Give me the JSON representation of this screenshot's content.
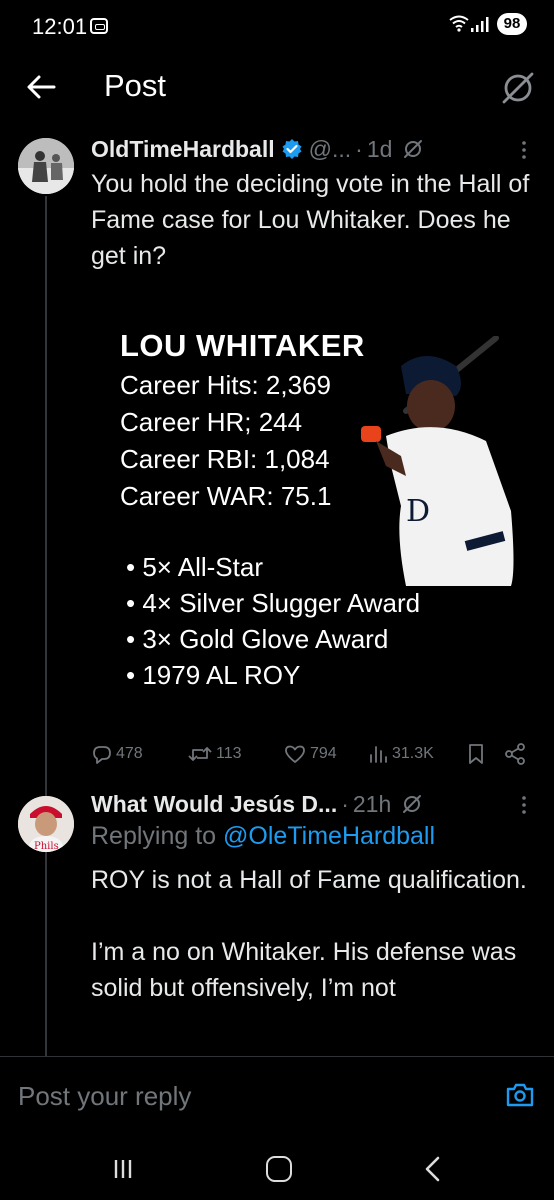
{
  "status_bar": {
    "time": "12:01",
    "battery": "98"
  },
  "header": {
    "title": "Post"
  },
  "post": {
    "display_name": "OldTimeHardball",
    "handle": "@...",
    "separator": "·",
    "time": "1d",
    "text": "You hold the deciding vote in the Hall of Fame case for Lou Whitaker. Does he get in?",
    "card": {
      "title": "LOU WHITAKER",
      "stats": [
        "Career Hits: 2,369",
        "Career HR; 244",
        "Career RBI: 1,084",
        "Career WAR: 75.1"
      ],
      "bullets": [
        "• 5× All-Star",
        "• 4× Silver Slugger Award",
        "• 3× Gold Glove Award",
        "• 1979 AL ROY"
      ]
    },
    "actions": {
      "replies": "478",
      "reposts": "113",
      "likes": "794",
      "views": "31.3K"
    }
  },
  "reply": {
    "display_name": "What Would Jesús D...",
    "separator": "·",
    "time": "21h",
    "replying_to_prefix": "Replying to ",
    "replying_to_handle": "@OleTimeHardball",
    "text_p1": "ROY is not a Hall of Fame qualification.",
    "text_p2": "I’m a no on Whitaker. His defense was solid but offensively, I’m not"
  },
  "reply_bar": {
    "placeholder": "Post your reply"
  },
  "colors": {
    "accent": "#1d9bf0",
    "muted": "#71767b",
    "text": "#e7e9ea",
    "background": "#000000"
  }
}
